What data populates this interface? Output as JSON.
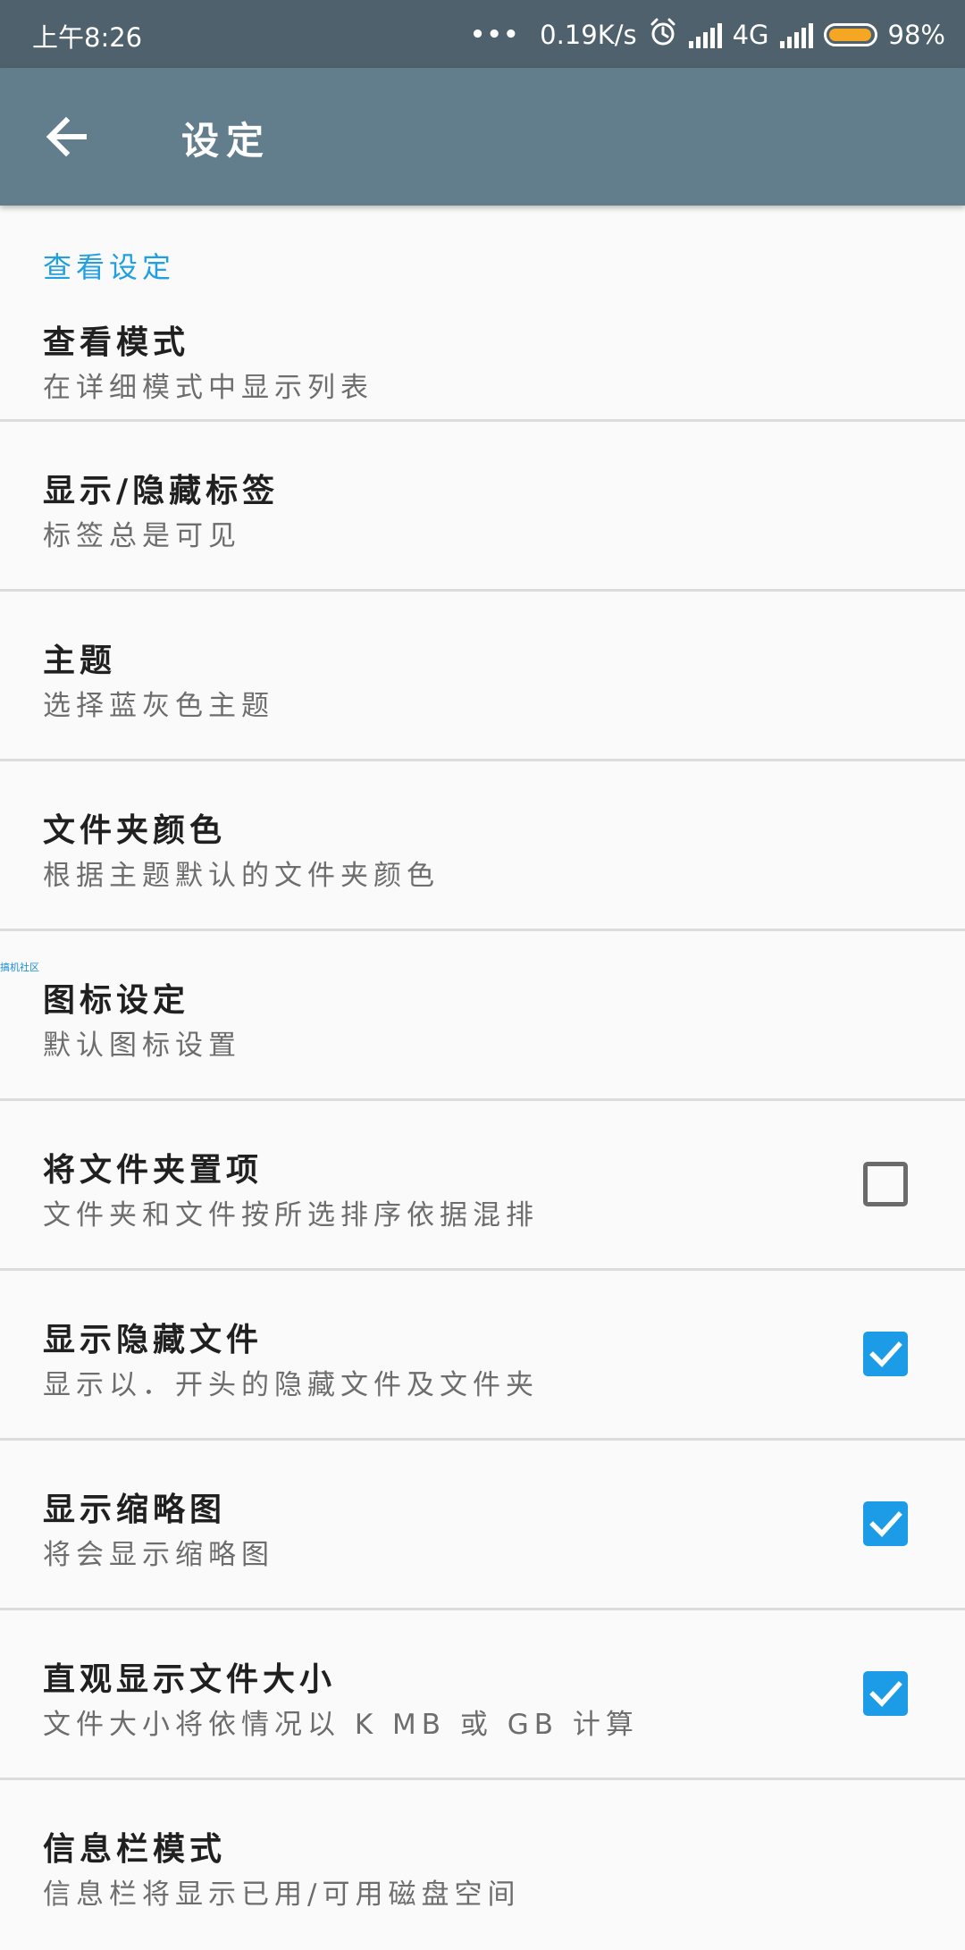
{
  "status_bar": {
    "time": "上午8:26",
    "dots": "•••",
    "speed": "0.19K/s",
    "network": "4G",
    "battery_percent_text": "98%",
    "battery_level": 0.98,
    "icons": [
      "alarm-icon",
      "signal-icon",
      "battery-icon"
    ]
  },
  "app_bar": {
    "title": "设定",
    "back_icon": "arrow-left-icon"
  },
  "section": {
    "header": "查看设定"
  },
  "preferences": [
    {
      "title": "查看模式",
      "summary": "在详细模式中显示列表"
    },
    {
      "title": "显示/隐藏标签",
      "summary": "标签总是可见"
    },
    {
      "title": "主题",
      "summary": "选择蓝灰色主题"
    },
    {
      "title": "文件夹颜色",
      "summary": "根据主题默认的文件夹颜色"
    },
    {
      "title": "图标设定",
      "summary": "默认图标设置"
    },
    {
      "title": "将文件夹置项",
      "summary": "文件夹和文件按所选排序依据混排",
      "checked": false
    },
    {
      "title": "显示隐藏文件",
      "summary": "显示以．开头的隐藏文件及文件夹",
      "checked": true
    },
    {
      "title": "显示缩略图",
      "summary": "将会显示缩略图",
      "checked": true
    },
    {
      "title": "直观显示文件大小",
      "summary": "文件大小将依情况以 K MB 或 GB 计算",
      "checked": true
    },
    {
      "title": "信息栏模式",
      "summary": "信息栏将显示已用/可用磁盘空间"
    }
  ],
  "watermark": "搞机社区",
  "colors": {
    "status_bar": "#4e616c",
    "app_bar": "#627e8c",
    "accent": "#1c9ce6",
    "section_header": "#20a0e0",
    "battery": "#f5a623"
  }
}
